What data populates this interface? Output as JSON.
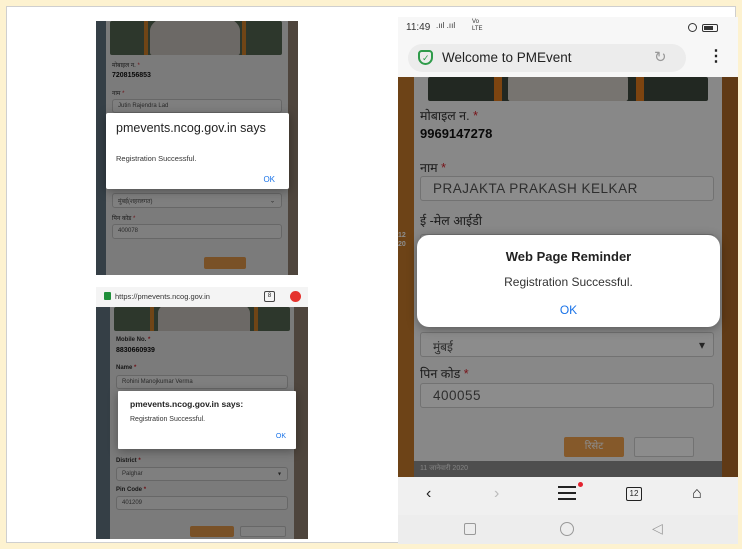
{
  "shot1": {
    "mobile_label": "मोबाइल न.",
    "mobile_value": "7208156853",
    "name_label": "नाम",
    "name_value": "Jutin Rajendra Lad",
    "district_value": "मुंबई(शहरलगत)",
    "pincode_label": "पिन कोड",
    "pincode_value": "400078",
    "dialog": {
      "title": "pmevents.ncog.gov.in says",
      "message": "Registration Successful.",
      "ok": "OK"
    }
  },
  "shot2": {
    "url": "https://pmevents.ncog.gov.in",
    "tabs_count": "8",
    "mobile_label": "Mobile No.",
    "mobile_value": "8830660939",
    "name_label": "Name",
    "name_value": "Rohini Manojkumar Verma",
    "district_label": "District",
    "district_value": "Palghar",
    "pincode_label": "Pin Code",
    "pincode_value": "401209",
    "dialog": {
      "title": "pmevents.ncog.gov.in says:",
      "message": "Registration Successful.",
      "ok": "OK"
    }
  },
  "phone": {
    "status_time": "11:49",
    "status_signal": ".ııl .ııl",
    "status_net": "Vo LTE",
    "page_title": "Welcome to PMEvent",
    "mobile_label": "मोबाइल न.",
    "mobile_value": "9969147278",
    "name_label": "नाम",
    "name_value": "PRAJAKTA PRAKASH KELKAR",
    "email_label": "ई -मेल आईडी",
    "district_value": "मुंबई",
    "pincode_label": "पिन कोड",
    "pincode_value": "400055",
    "reset_label": "रिसेट",
    "peek_text": "11 जानेवारी 2020",
    "tab_count": "12",
    "side_date": "12",
    "side_year": "20",
    "dialog": {
      "title": "Web Page Reminder",
      "message": "Registration Successful.",
      "ok": "OK"
    }
  },
  "colors": {
    "accent_blue": "#1a73e8",
    "required_red": "#d9232e",
    "submit_orange": "#f2a24e",
    "background_cream": "#fdf2d0"
  }
}
